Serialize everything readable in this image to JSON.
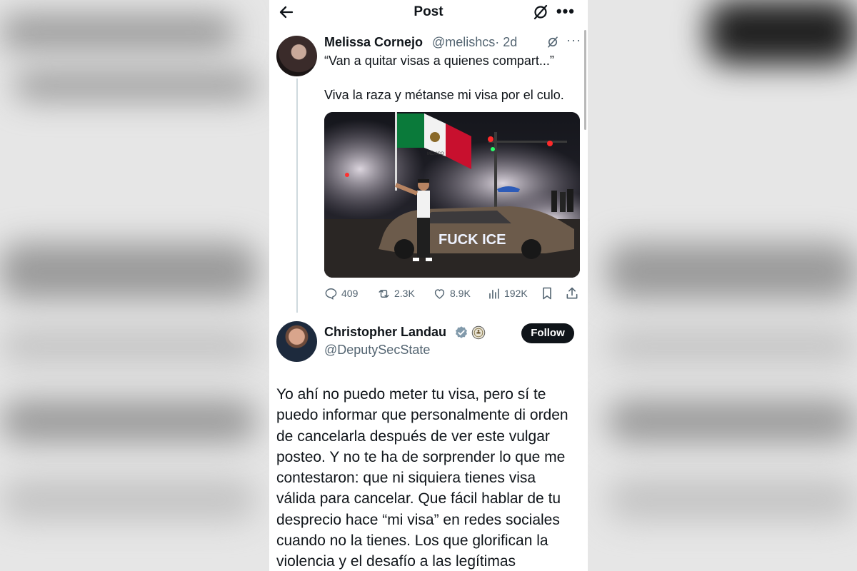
{
  "header": {
    "title": "Post",
    "back_icon": "arrow-left-icon",
    "grok_icon": "grok-icon",
    "more_icon": "more-horizontal-icon"
  },
  "original_post": {
    "author_name": "Melissa Cornejo",
    "handle": "@melishcs",
    "time": "· 2d",
    "text_lines": [
      "“Van a quitar visas a quienes compart...”",
      "Viva la raza y métanse mi visa por el culo."
    ],
    "image_description": "",
    "actions": {
      "replies": "409",
      "reposts": "2.3K",
      "likes": "8.9K",
      "views": "192K"
    }
  },
  "reply": {
    "author_name": "Christopher Landau",
    "handle": "@DeputySecState",
    "follow_label": "Follow",
    "body_lines": [
      "Yo ahí no puedo meter tu visa, pero sí te",
      "puedo informar que personalmente di orden",
      "de cancelarla después de ver este vulgar",
      "posteo. Y no te ha de sorprender lo que me",
      "contestaron: que ni siquiera tienes visa",
      "válida para cancelar. Que fácil hablar de tu",
      "desprecio hace “mi visa” en redes sociales",
      "cuando no la tienes. Los que glorifican la",
      "violencia y el desafío a las legítimas"
    ]
  },
  "image_text": {
    "graffiti": "FUCK ICE",
    "flag_text": "MÉXICO"
  },
  "colors": {
    "accent": "#1d9bf0",
    "text": "#0f1419",
    "muted": "#536471",
    "follow_bg": "#0f1419",
    "flag_green": "#0a7a3a",
    "flag_red": "#c8102e"
  }
}
